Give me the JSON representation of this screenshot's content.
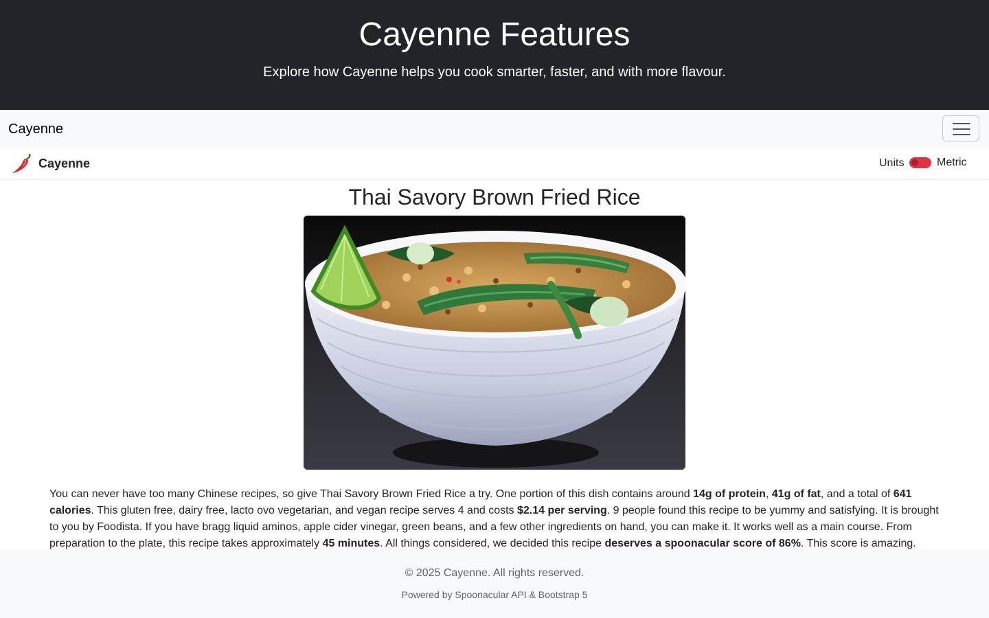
{
  "hero": {
    "title": "Cayenne Features",
    "subtitle": "Explore how Cayenne helps you cook smarter, faster, and with more flavour."
  },
  "navbar": {
    "brand": "Cayenne",
    "toggler_icon": "hamburger-menu-icon"
  },
  "subnav": {
    "logo_icon": "chili-pepper-icon",
    "brand": "Cayenne",
    "units_label": "Units",
    "metric_label": "Metric",
    "toggle_color": "#dc3545"
  },
  "recipe": {
    "title": "Thai Savory Brown Fried Rice",
    "image_alt": "bowl of fried rice with green beans and lime",
    "summary": {
      "p1": "You can never have too many Chinese recipes, so give Thai Savory Brown Fried Rice a try. One portion of this dish contains around ",
      "b1": "14g of protein",
      "p2": ", ",
      "b2": "41g of fat",
      "p3": ", and a total of ",
      "b3": "641 calories",
      "p4": ". This gluten free, dairy free, lacto ovo vegetarian, and vegan recipe serves 4 and costs ",
      "b4": "$2.14 per serving",
      "p5": ". 9 people found this recipe to be yummy and satisfying. It is brought to you by Foodista. If you have bragg liquid aminos, apple cider vinegar, green beans, and a few other ingredients on hand, you can make it. It works well as a main course. From preparation to the plate, this recipe takes approximately ",
      "b5": "45 minutes",
      "p6": ". All things considered, we decided this recipe ",
      "b6": "deserves a spoonacular score of 86%",
      "p7": ". This score is amazing."
    }
  },
  "footer": {
    "copyright": "© 2025 Cayenne. All rights reserved.",
    "powered": "Powered by Spoonacular API & Bootstrap 5"
  }
}
